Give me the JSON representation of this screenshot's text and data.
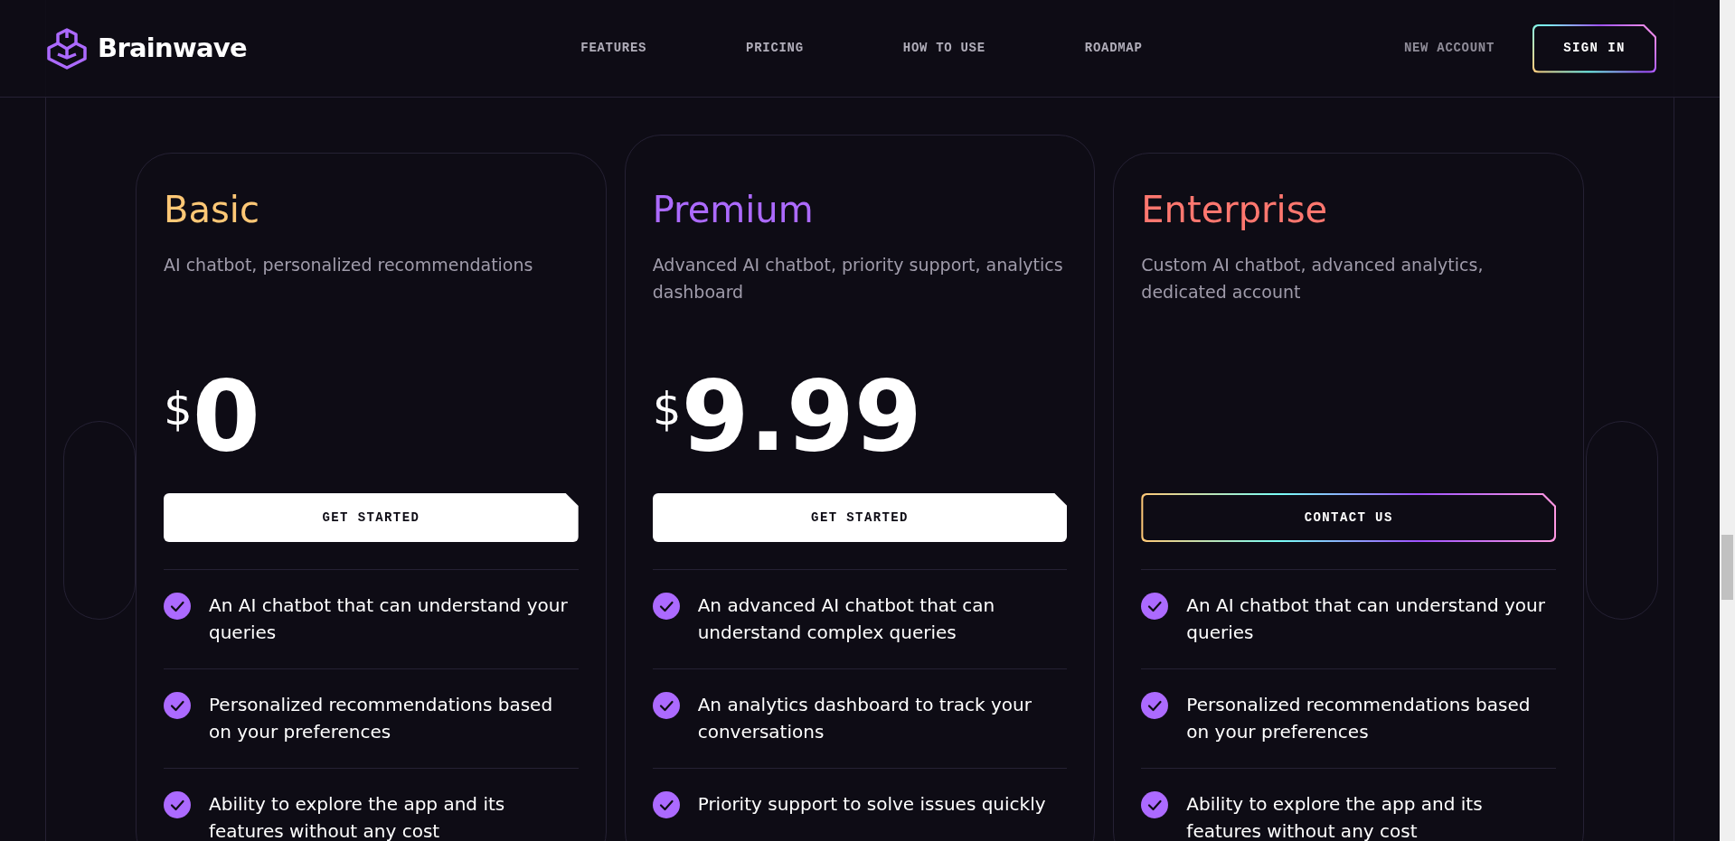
{
  "header": {
    "logo": "Brainwave",
    "nav": [
      {
        "label": "FEATURES"
      },
      {
        "label": "PRICING"
      },
      {
        "label": "HOW TO USE"
      },
      {
        "label": "ROADMAP"
      }
    ],
    "new_account": "NEW ACCOUNT",
    "sign_in": "SIGN IN"
  },
  "plans": [
    {
      "name": "Basic",
      "color": "#ffc876",
      "description": "AI chatbot, personalized recommendations",
      "currency": "$",
      "price": "0",
      "button": {
        "label": "GET STARTED",
        "kind": "solid"
      },
      "features": [
        "An AI chatbot that can understand your queries",
        "Personalized recommendations based on your preferences",
        "Ability to explore the app and its features without any cost"
      ]
    },
    {
      "name": "Premium",
      "color": "#ac6aff",
      "description": "Advanced AI chatbot, priority support, analytics dashboard",
      "currency": "$",
      "price": "9.99",
      "button": {
        "label": "GET STARTED",
        "kind": "solid"
      },
      "features": [
        "An advanced AI chatbot that can understand complex queries",
        "An analytics dashboard to track your conversations",
        "Priority support to solve issues quickly"
      ]
    },
    {
      "name": "Enterprise",
      "color": "#ff776f",
      "description": "Custom AI chatbot, advanced analytics, dedicated account",
      "button": {
        "label": "CONTACT US",
        "kind": "gradient"
      },
      "features": [
        "An AI chatbot that can understand your queries",
        "Personalized recommendations based on your preferences",
        "Ability to explore the app and its features without any cost"
      ]
    }
  ]
}
